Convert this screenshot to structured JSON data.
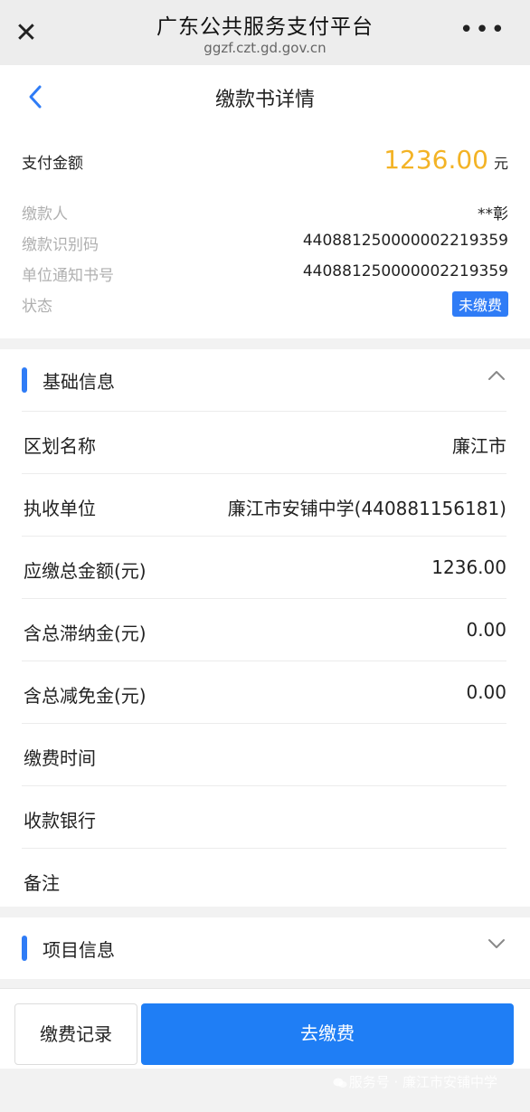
{
  "browser": {
    "title": "广东公共服务支付平台",
    "url": "ggzf.czt.gd.gov.cn",
    "close_icon": "close-icon",
    "more_icon": "more-icon",
    "close_glyph": "✕",
    "more_glyph": "•••"
  },
  "nav": {
    "title": "缴款书详情",
    "back_icon": "back-arrow-icon"
  },
  "summary": {
    "amount_label": "支付金额",
    "amount": "1236.00",
    "amount_unit": "元",
    "payer_label": "缴款人",
    "payer": "**彰",
    "payment_code_label": "缴款识别码",
    "payment_code": "440881250000002219359",
    "notice_no_label": "单位通知书号",
    "notice_no": "440881250000002219359",
    "status_label": "状态",
    "status": "未缴费"
  },
  "basic_info": {
    "title": "基础信息",
    "expanded": true,
    "rows": [
      {
        "label": "区划名称",
        "value": "廉江市"
      },
      {
        "label": "执收单位",
        "value": "廉江市安铺中学(440881156181)"
      },
      {
        "label": "应缴总金额(元)",
        "value": "1236.00"
      },
      {
        "label": "含总滞纳金(元)",
        "value": "0.00"
      },
      {
        "label": "含总减免金(元)",
        "value": "0.00"
      },
      {
        "label": "缴费时间",
        "value": ""
      },
      {
        "label": "收款银行",
        "value": ""
      },
      {
        "label": "备注",
        "value": ""
      }
    ]
  },
  "project_info": {
    "title": "项目信息",
    "expanded": false
  },
  "bottom": {
    "record_label": "缴费记录",
    "pay_label": "去缴费",
    "watermark": "服务号 · 廉江市安铺中学"
  },
  "colors": {
    "accent": "#2f7cf6",
    "amount": "#f3b325",
    "pay_button": "#1f7ef5"
  }
}
